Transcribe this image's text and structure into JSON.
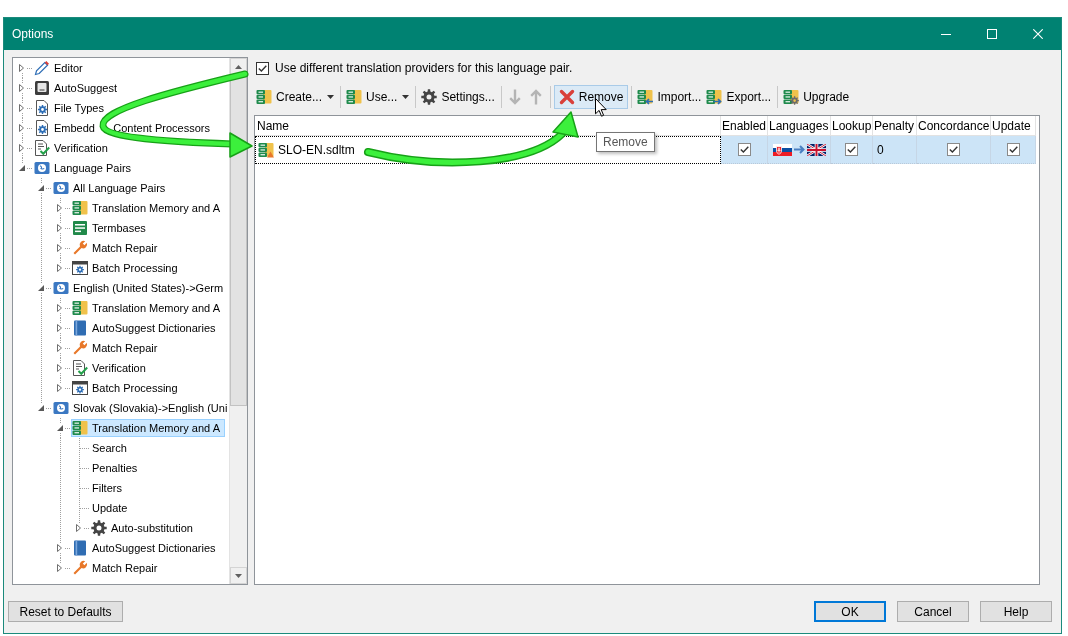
{
  "window": {
    "title": "Options"
  },
  "tree": [
    {
      "label": "Editor",
      "kind": "editor",
      "expanded": false,
      "selected": false
    },
    {
      "label": "AutoSuggest",
      "kind": "autosuggest",
      "expanded": false,
      "selected": false
    },
    {
      "label": "File Types",
      "kind": "filetypes",
      "expanded": false,
      "selected": false
    },
    {
      "label": "Embedd      Content Processors",
      "kind": "processors",
      "expanded": false,
      "selected": false
    },
    {
      "label": "Verification",
      "kind": "verification",
      "expanded": false,
      "selected": false
    },
    {
      "label": "Language Pairs",
      "kind": "languages",
      "expanded": true,
      "selected": false,
      "children": [
        {
          "label": "All Language Pairs",
          "kind": "languages",
          "expanded": true,
          "selected": false,
          "children": [
            {
              "label": "Translation Memory and A",
              "kind": "memory",
              "expanded": false,
              "selected": false
            },
            {
              "label": "Termbases",
              "kind": "termbase",
              "expanded": false,
              "selected": false
            },
            {
              "label": "Match Repair",
              "kind": "repair",
              "expanded": false,
              "selected": false
            },
            {
              "label": "Batch Processing",
              "kind": "batch",
              "expanded": false,
              "selected": false
            }
          ]
        },
        {
          "label": "English (United States)->Germ",
          "kind": "languages",
          "expanded": true,
          "selected": false,
          "children": [
            {
              "label": "Translation Memory and A",
              "kind": "memory",
              "expanded": false,
              "selected": false
            },
            {
              "label": "AutoSuggest Dictionaries",
              "kind": "dictionary",
              "expanded": false,
              "selected": false
            },
            {
              "label": "Match Repair",
              "kind": "repair",
              "expanded": false,
              "selected": false
            },
            {
              "label": "Verification",
              "kind": "verification",
              "expanded": false,
              "selected": false
            },
            {
              "label": "Batch Processing",
              "kind": "batch",
              "expanded": false,
              "selected": false
            }
          ]
        },
        {
          "label": "Slovak (Slovakia)->English (Uni",
          "kind": "languages",
          "expanded": true,
          "selected": false,
          "children": [
            {
              "label": "Translation Memory and A",
              "kind": "memory",
              "expanded": true,
              "selected": true,
              "children": [
                {
                  "label": "Search",
                  "kind": "page",
                  "selected": false
                },
                {
                  "label": "Penalties",
                  "kind": "page",
                  "selected": false
                },
                {
                  "label": "Filters",
                  "kind": "page",
                  "selected": false
                },
                {
                  "label": "Update",
                  "kind": "page",
                  "selected": false
                },
                {
                  "label": "Auto-substitution",
                  "kind": "settings",
                  "expanded": false,
                  "selected": false
                }
              ]
            },
            {
              "label": "AutoSuggest Dictionaries",
              "kind": "dictionary",
              "expanded": false,
              "selected": false
            },
            {
              "label": "Match Repair",
              "kind": "repair",
              "expanded": false,
              "selected": false
            }
          ]
        }
      ]
    }
  ],
  "provider_option": {
    "label": "Use different translation providers for this language pair.",
    "checked": true
  },
  "toolbar": [
    {
      "kind": "create",
      "label": "Create...",
      "dropdown": true,
      "disabled": false,
      "hovered": false
    },
    {
      "kind": "separator"
    },
    {
      "kind": "use",
      "label": "Use...",
      "dropdown": true,
      "disabled": false,
      "hovered": false
    },
    {
      "kind": "separator"
    },
    {
      "kind": "settings",
      "label": "Settings...",
      "dropdown": false,
      "disabled": false,
      "hovered": false
    },
    {
      "kind": "separator"
    },
    {
      "kind": "down",
      "dropdown": false,
      "disabled": true,
      "hovered": false
    },
    {
      "kind": "up",
      "dropdown": false,
      "disabled": true,
      "hovered": false
    },
    {
      "kind": "separator"
    },
    {
      "kind": "remove",
      "label": "Remove",
      "dropdown": false,
      "disabled": false,
      "hovered": true
    },
    {
      "kind": "separator"
    },
    {
      "kind": "import",
      "label": "Import...",
      "dropdown": false,
      "disabled": false,
      "hovered": false
    },
    {
      "kind": "export",
      "label": "Export...",
      "dropdown": false,
      "disabled": false,
      "hovered": false
    },
    {
      "kind": "separator"
    },
    {
      "kind": "upgrade",
      "label": "Upgrade",
      "dropdown": false,
      "disabled": false,
      "hovered": false
    }
  ],
  "tooltip": {
    "text": "Remove"
  },
  "table": {
    "columns": [
      "Name",
      "Enabled",
      "Languages",
      "Lookup",
      "Penalty",
      "Concordance",
      "Update"
    ],
    "rows": [
      {
        "selected": true,
        "cells": [
          {
            "kind": "name",
            "text": "SLO-EN.sdltm",
            "focused": true
          },
          {
            "kind": "check",
            "checked": true,
            "focused": false
          },
          {
            "kind": "flags",
            "focused": false
          },
          {
            "kind": "check",
            "checked": true,
            "focused": false
          },
          {
            "kind": "text",
            "text": "0",
            "focused": false
          },
          {
            "kind": "check",
            "checked": true,
            "focused": false
          },
          {
            "kind": "check",
            "checked": true,
            "focused": false
          }
        ]
      }
    ]
  },
  "reset_button": {
    "label": "Reset to Defaults"
  },
  "buttons": [
    {
      "label": "OK",
      "default": true
    },
    {
      "label": "Cancel",
      "default": false
    },
    {
      "label": "Help",
      "default": false
    }
  ]
}
